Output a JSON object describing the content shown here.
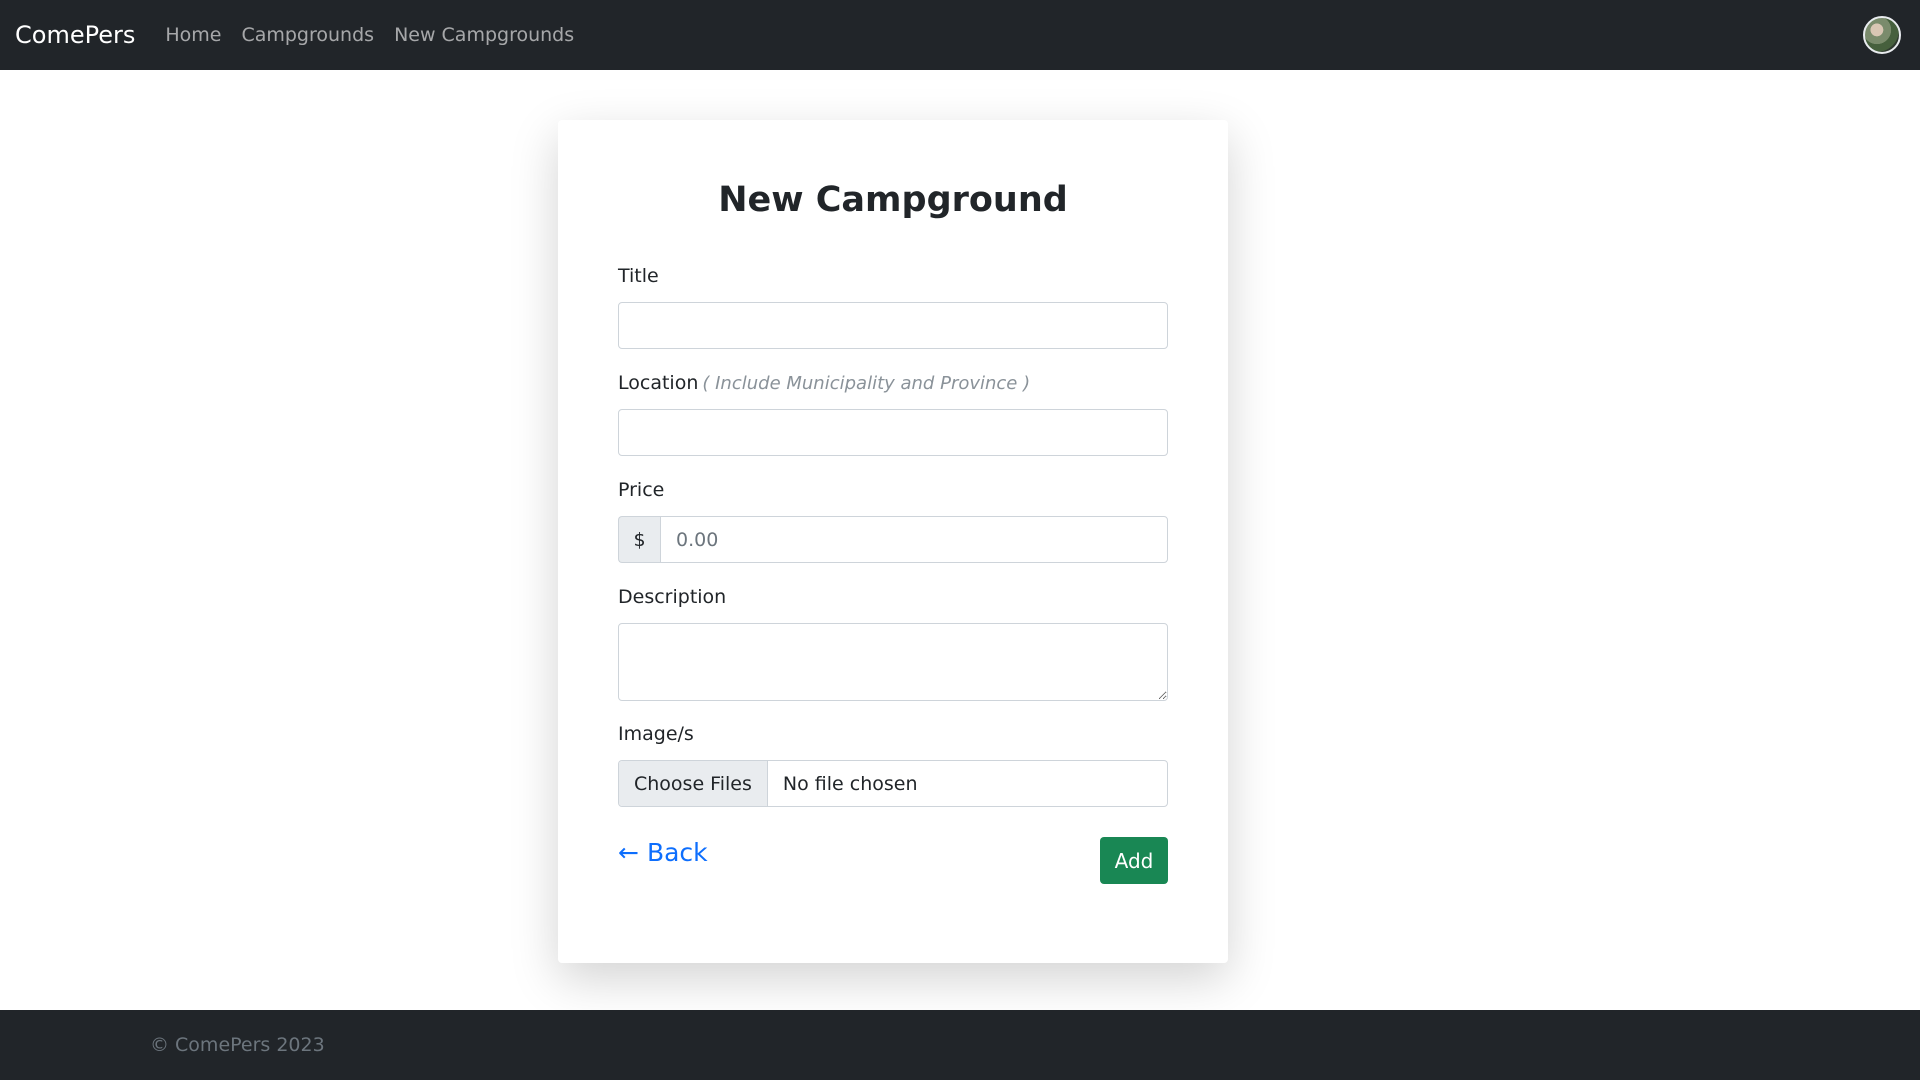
{
  "navbar": {
    "brand": "ComePers",
    "links": [
      "Home",
      "Campgrounds",
      "New Campgrounds"
    ],
    "avatar_icon": "user-avatar"
  },
  "form": {
    "title": "New Campground",
    "title_label": "Title",
    "title_value": "",
    "location_label": "Location",
    "location_hint": "( Include Municipality and Province )",
    "location_value": "",
    "price_label": "Price",
    "price_prefix": "$",
    "price_placeholder": "0.00",
    "description_label": "Description",
    "description_value": "",
    "images_label": "Image/s",
    "file_button": "Choose Files",
    "file_status": "No file chosen",
    "back_arrow": "←",
    "back_label": "Back",
    "add_label": "Add"
  },
  "footer": {
    "text": "© ComePers 2023"
  },
  "colors": {
    "navbar_bg": "#212529",
    "add_button": "#198754",
    "link": "#0d6efd"
  }
}
